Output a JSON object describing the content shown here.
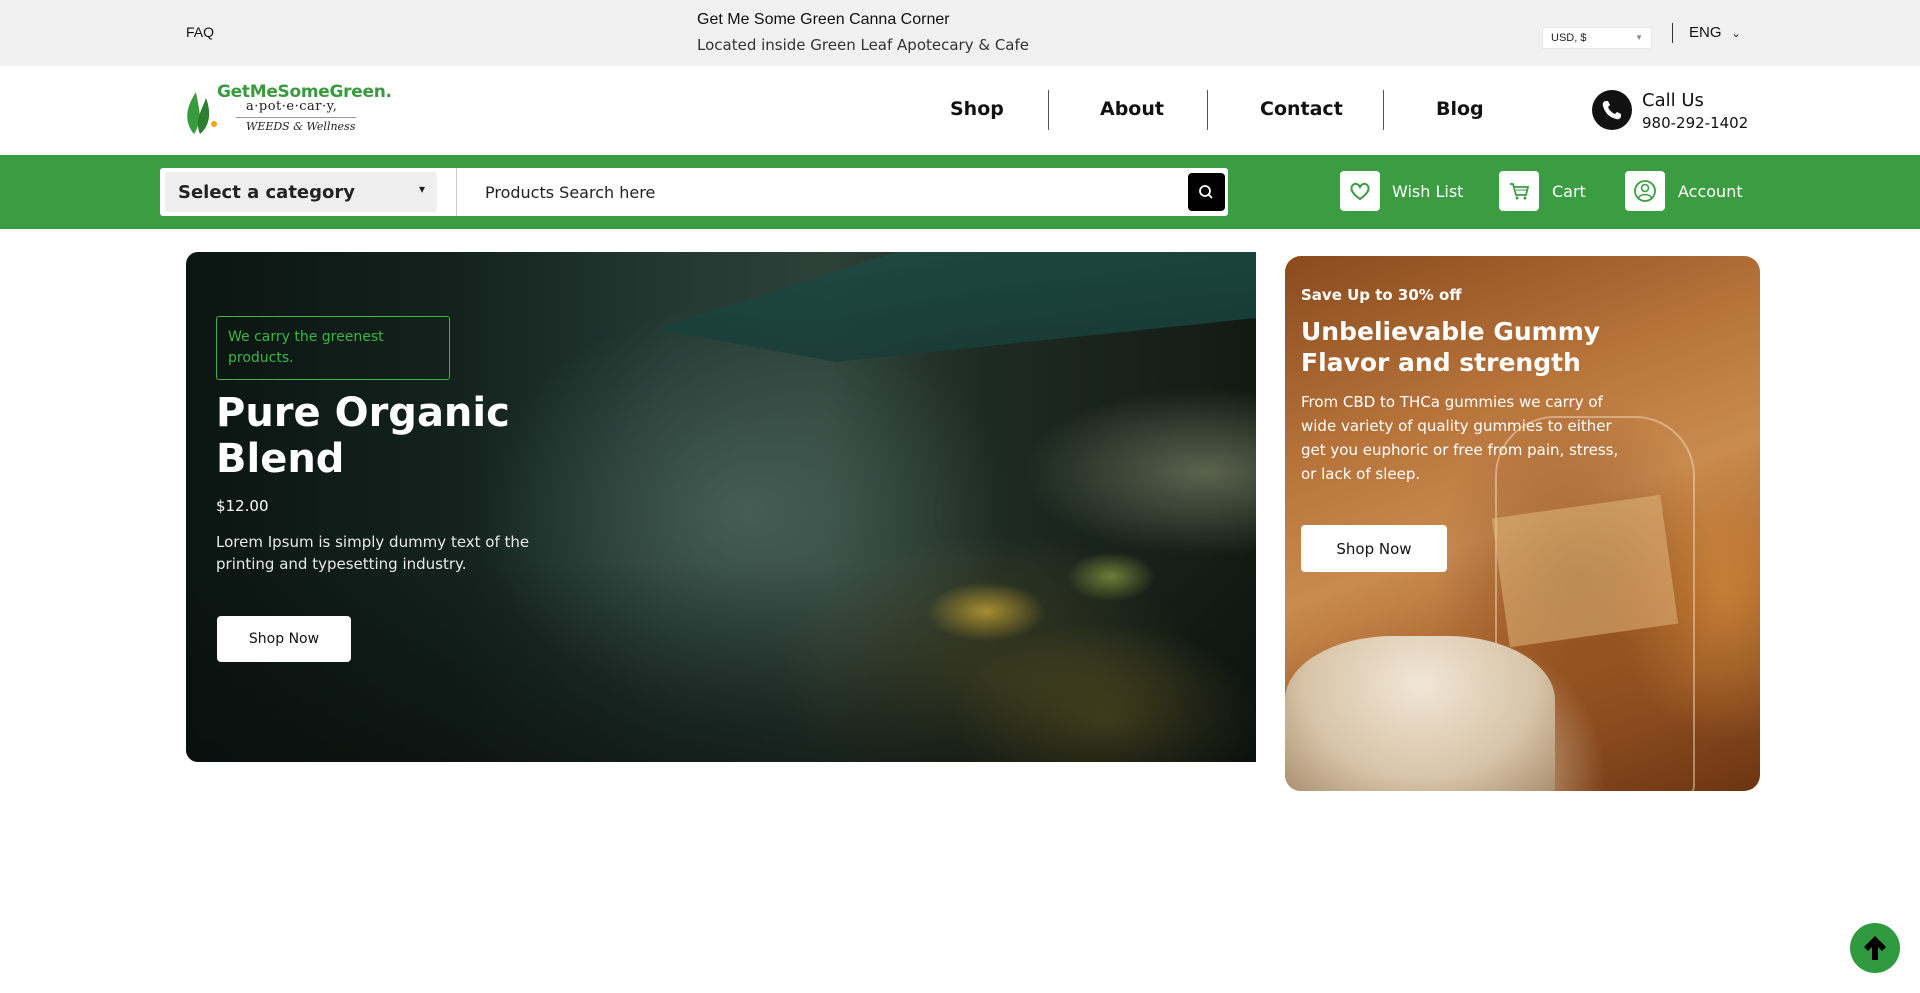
{
  "topbar": {
    "faq": "FAQ",
    "store_name": "Get Me Some Green Canna Corner",
    "store_location": "Located inside Green Leaf Apotecary & Cafe",
    "currency": "USD, $",
    "language": "ENG"
  },
  "logo": {
    "title": "GetMeSomeGreen.",
    "subtitle": "a·pot·e·car·y,",
    "tagline": "WEEDS & Wellness"
  },
  "nav": {
    "items": [
      {
        "label": "Shop"
      },
      {
        "label": "About"
      },
      {
        "label": "Contact"
      },
      {
        "label": "Blog"
      }
    ]
  },
  "contact": {
    "label": "Call Us",
    "phone": "980-292-1402"
  },
  "search": {
    "category_label": "Select a category",
    "placeholder": "Products Search here"
  },
  "utility": {
    "wishlist": "Wish List",
    "cart": "Cart",
    "account": "Account"
  },
  "hero": {
    "badge": "We carry the greenest products.",
    "title": "Pure Organic Blend",
    "price": "$12.00",
    "description": "Lorem Ipsum is simply dummy text of the printing and typesetting industry.",
    "button": "Shop Now"
  },
  "promo": {
    "offer": "Save Up to 30% off",
    "title": "Unbelievable Gummy Flavor and strength",
    "description": "From CBD to THCa gummies we carry of wide variety of quality gummies to either get you euphoric or free from pain, stress, or lack of sleep.",
    "button": "Shop Now"
  },
  "colors": {
    "brand_green": "#3b9c42",
    "badge_green": "#3bb547",
    "topbar_bg": "#f1f1f1"
  },
  "icons": {
    "phone": "phone-icon",
    "search": "search-icon",
    "wishlist": "heart-icon",
    "cart": "cart-icon",
    "account": "user-icon",
    "scroll_top": "arrow-up-icon"
  }
}
